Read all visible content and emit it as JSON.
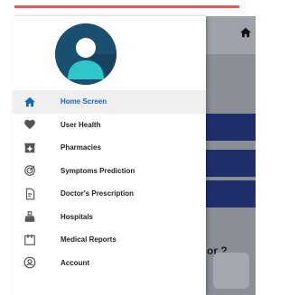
{
  "background": {
    "question_text": "or ?",
    "home_icon": "home-icon"
  },
  "drawer": {
    "avatar_icon": "user-avatar-icon",
    "accent_color": "#1565c0",
    "items": [
      {
        "label": "Home Screen",
        "icon": "home-icon",
        "active": true
      },
      {
        "label": "User Health",
        "icon": "heart-icon",
        "active": false
      },
      {
        "label": "Pharmacies",
        "icon": "pharmacy-icon",
        "active": false
      },
      {
        "label": "Symptoms Prediction",
        "icon": "prediction-icon",
        "active": false
      },
      {
        "label": "Doctor's Prescription",
        "icon": "prescription-icon",
        "active": false
      },
      {
        "label": "Hospitals",
        "icon": "hospital-icon",
        "active": false
      },
      {
        "label": "Medical Reports",
        "icon": "report-icon",
        "active": false
      },
      {
        "label": "Account",
        "icon": "account-icon",
        "active": false
      }
    ]
  }
}
